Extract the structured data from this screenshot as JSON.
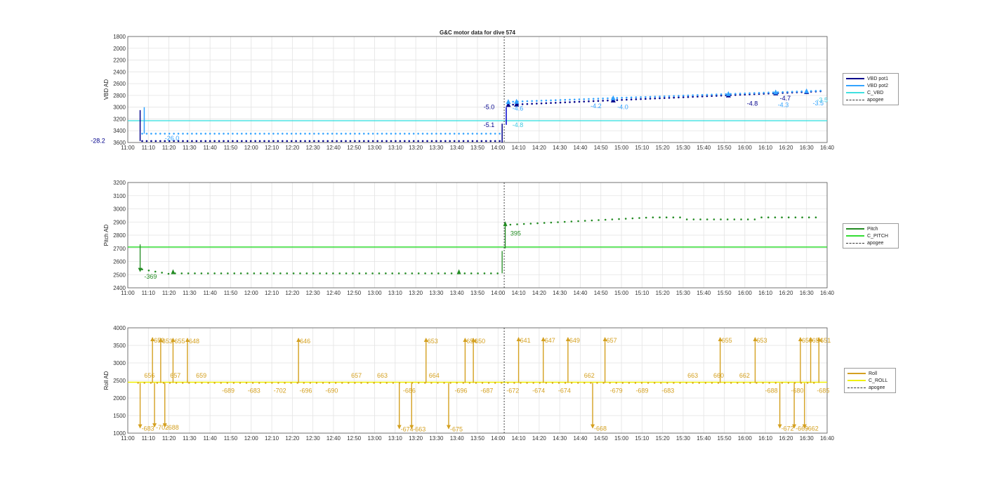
{
  "chart_data": [
    {
      "type": "line",
      "title": "G&C motor data for dive 574",
      "ylabel": "VBD AD",
      "xlabel": "",
      "y_reversed": true,
      "ylim": [
        1800,
        3600
      ],
      "yticks": [
        1800,
        2000,
        2200,
        2400,
        2600,
        2800,
        3000,
        3200,
        3400,
        3600
      ],
      "xlim": [
        "11:00",
        "16:40"
      ],
      "xticks": [
        "11:00",
        "11:10",
        "11:20",
        "11:30",
        "11:40",
        "11:50",
        "12:00",
        "12:10",
        "12:20",
        "12:30",
        "12:40",
        "12:50",
        "13:00",
        "13:10",
        "13:20",
        "13:30",
        "13:40",
        "13:50",
        "14:00",
        "14:10",
        "14:20",
        "14:30",
        "14:40",
        "14:50",
        "15:00",
        "15:10",
        "15:20",
        "15:30",
        "15:40",
        "15:50",
        "16:00",
        "16:10",
        "16:20",
        "16:30",
        "16:40"
      ],
      "grid": true,
      "legend_position": "right",
      "legend": [
        "VBD pot1",
        "VBD pot2",
        "C_VBD",
        "apogee"
      ],
      "apogee": "14:03",
      "reference_line": {
        "name": "C_VBD",
        "y": 3230,
        "color": "#3fe0e0"
      },
      "series": [
        {
          "name": "VBD pot1",
          "color": "#00008b",
          "start": "11:06",
          "end": "16:37",
          "y_start": 3575,
          "y_end": 2730,
          "descent_y": 3575,
          "ascent_y_start": 2960,
          "ascent_y_end": 2730
        },
        {
          "name": "VBD pot2",
          "color": "#33a3ff",
          "start": "11:06",
          "end": "16:37",
          "y_start": 3450,
          "y_end": 2720,
          "descent_y": 3450,
          "ascent_y_start": 2910,
          "ascent_y_end": 2720
        }
      ],
      "annotations": [
        "-28.2",
        "-26.0",
        "-5.0",
        "-5.1",
        "-4.8",
        "-4.6",
        "-4.2",
        "-4.0",
        "-4.8",
        "-4.3",
        "-4.7",
        "-3.5",
        "-3.5"
      ]
    },
    {
      "type": "line",
      "title": "",
      "ylabel": "Pitch AD",
      "xlabel": "",
      "ylim": [
        2400,
        3200
      ],
      "yticks": [
        2400,
        2500,
        2600,
        2700,
        2800,
        2900,
        3000,
        3100,
        3200
      ],
      "xlim": [
        "11:00",
        "16:40"
      ],
      "xticks": [
        "11:00",
        "11:10",
        "11:20",
        "11:30",
        "11:40",
        "11:50",
        "12:00",
        "12:10",
        "12:20",
        "12:30",
        "12:40",
        "12:50",
        "13:00",
        "13:10",
        "13:20",
        "13:30",
        "13:40",
        "13:50",
        "14:00",
        "14:10",
        "14:20",
        "14:30",
        "14:40",
        "14:50",
        "15:00",
        "15:10",
        "15:20",
        "15:30",
        "15:40",
        "15:50",
        "16:00",
        "16:10",
        "16:20",
        "16:30",
        "16:40"
      ],
      "grid": true,
      "legend_position": "right",
      "legend": [
        "Pitch",
        "C_PITCH",
        "apogee"
      ],
      "apogee": "14:03",
      "reference_line": {
        "name": "C_PITCH",
        "y": 2710,
        "color": "#33dd33"
      },
      "series": [
        {
          "name": "Pitch",
          "color": "#228b22",
          "descent_y": 2510,
          "ascent_y_start": 2880,
          "ascent_y_end": 2935
        }
      ],
      "annotations": [
        "-369",
        "395"
      ]
    },
    {
      "type": "line",
      "title": "",
      "ylabel": "Roll AD",
      "xlabel": "",
      "ylim": [
        1000,
        4000
      ],
      "yticks": [
        1000,
        1500,
        2000,
        2500,
        3000,
        3500,
        4000
      ],
      "xlim": [
        "11:00",
        "16:40"
      ],
      "xticks": [
        "11:00",
        "11:10",
        "11:20",
        "11:30",
        "11:40",
        "11:50",
        "12:00",
        "12:10",
        "12:20",
        "12:30",
        "12:40",
        "12:50",
        "13:00",
        "13:10",
        "13:20",
        "13:30",
        "13:40",
        "13:50",
        "14:00",
        "14:10",
        "14:20",
        "14:30",
        "14:40",
        "14:50",
        "15:00",
        "15:10",
        "15:20",
        "15:30",
        "15:40",
        "15:50",
        "16:00",
        "16:10",
        "16:20",
        "16:30",
        "16:40"
      ],
      "grid": true,
      "legend_position": "right",
      "legend": [
        "Roll",
        "C_ROLL",
        "apogee"
      ],
      "apogee": "14:03",
      "reference_line": {
        "name": "C_ROLL",
        "y": 2450,
        "color": "#f0f000"
      },
      "series": [
        {
          "name": "Roll",
          "color": "#d4a020",
          "baseline_y": 2430
        }
      ],
      "roll_events": [
        {
          "t": "11:06",
          "y": 1150,
          "label": "-683"
        },
        {
          "t": "11:12",
          "y": 3720,
          "label": "650"
        },
        {
          "t": "11:13",
          "y": 1180,
          "label": "-702"
        },
        {
          "t": "11:16",
          "y": 3700,
          "label": "653"
        },
        {
          "t": "11:18",
          "y": 1180,
          "label": "-688"
        },
        {
          "t": "11:22",
          "y": 3700,
          "label": "655"
        },
        {
          "t": "11:29",
          "y": 3700,
          "label": "648"
        },
        {
          "t": "12:23",
          "y": 3700,
          "label": "646"
        },
        {
          "t": "13:12",
          "y": 1130,
          "label": "-674"
        },
        {
          "t": "13:18",
          "y": 1130,
          "label": "-663"
        },
        {
          "t": "13:25",
          "y": 3700,
          "label": "653"
        },
        {
          "t": "13:36",
          "y": 1130,
          "label": "-675"
        },
        {
          "t": "13:44",
          "y": 3700,
          "label": "654"
        },
        {
          "t": "13:48",
          "y": 3700,
          "label": "650"
        },
        {
          "t": "14:10",
          "y": 3720,
          "label": "641"
        },
        {
          "t": "14:22",
          "y": 3720,
          "label": "647"
        },
        {
          "t": "14:34",
          "y": 3720,
          "label": "649"
        },
        {
          "t": "14:46",
          "y": 1150,
          "label": "-668"
        },
        {
          "t": "14:52",
          "y": 3720,
          "label": "657"
        },
        {
          "t": "15:48",
          "y": 3720,
          "label": "655"
        },
        {
          "t": "16:05",
          "y": 3720,
          "label": "653"
        },
        {
          "t": "16:17",
          "y": 1150,
          "label": "-672"
        },
        {
          "t": "16:24",
          "y": 1150,
          "label": "-669"
        },
        {
          "t": "16:27",
          "y": 3720,
          "label": "658"
        },
        {
          "t": "16:29",
          "y": 1150,
          "label": "-662"
        },
        {
          "t": "16:32",
          "y": 3720,
          "label": "654"
        },
        {
          "t": "16:36",
          "y": 3720,
          "label": "651"
        }
      ],
      "mid_labels": [
        "656",
        "657",
        "659",
        "-689",
        "-683",
        "-702",
        "-696",
        "-690",
        "657",
        "663",
        "-686",
        "664",
        "-696",
        "-687",
        "-672",
        "-674",
        "-674",
        "662",
        "-679",
        "-689",
        "-683",
        "663",
        "660",
        "662",
        "-688",
        "-680",
        "-685"
      ]
    }
  ]
}
